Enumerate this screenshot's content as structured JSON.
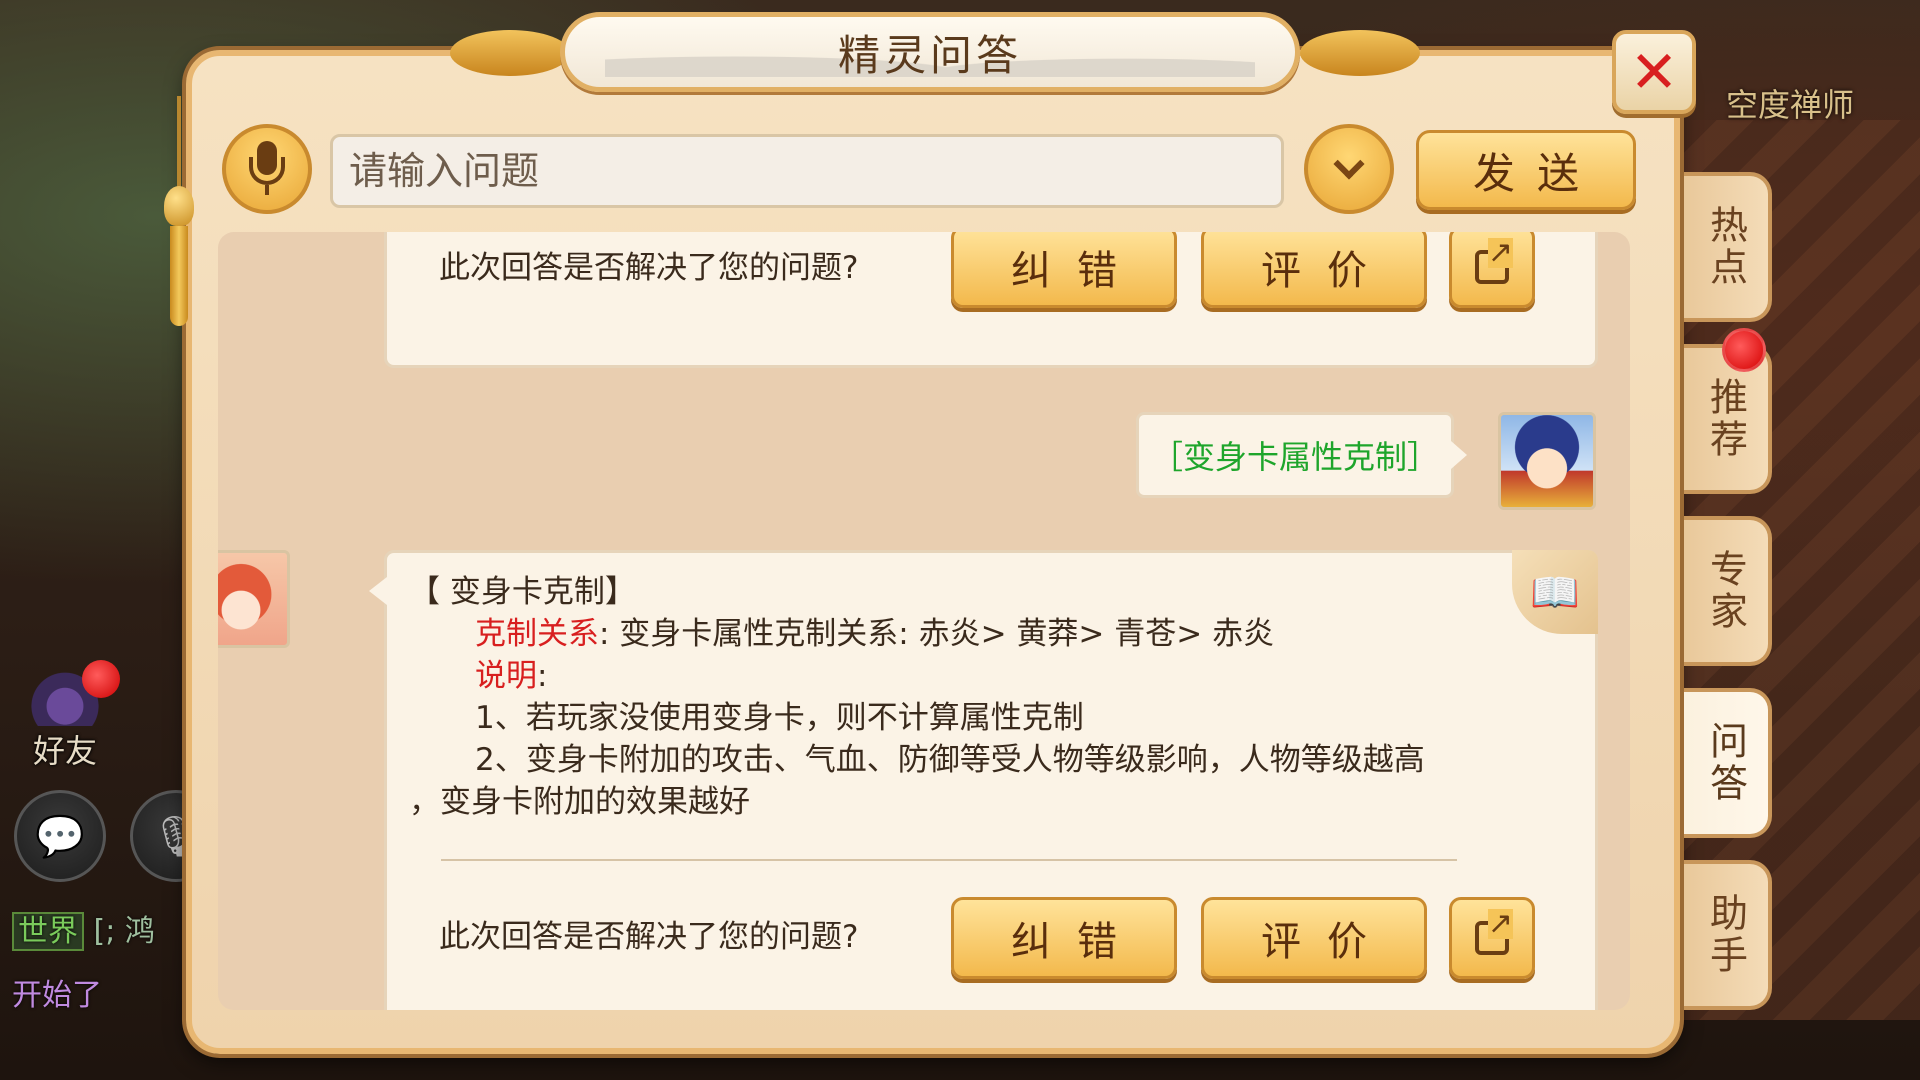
{
  "background": {
    "npc_name": "空度禅师",
    "hud": {
      "friend_label": "好友",
      "chat_world_tag": "世界",
      "chat_world_text": "[; 鸿",
      "chat_begin_text": "开始了"
    }
  },
  "dialog": {
    "title": "精灵问答",
    "search": {
      "placeholder": "请输入问题",
      "value": ""
    },
    "send_label": "发送",
    "tabs": [
      {
        "label": "热点",
        "active": false
      },
      {
        "label": "推荐",
        "active": false,
        "has_badge": true
      },
      {
        "label": "专家",
        "active": false
      },
      {
        "label": "问答",
        "active": true
      },
      {
        "label": "助手",
        "active": false
      }
    ],
    "messages": {
      "previous_feedback": {
        "question": "此次回答是否解决了您的问题?",
        "correct_label": "纠错",
        "rate_label": "评价"
      },
      "user_query": "［变身卡属性克制］",
      "answer": {
        "heading": "【 变身卡克制】",
        "restraint_label": "克制关系",
        "restraint_text": ": 变身卡属性克制关系: 赤炎> 黄莽> 青苍> 赤炎",
        "note_label": "说明",
        "note_colon": ":",
        "item1": "1、若玩家没使用变身卡，则不计算属性克制",
        "item2": "2、变身卡附加的攻击、气血、防御等受人物等级影响，人物等级越高",
        "item2_cont": "，变身卡附加的效果越好"
      },
      "current_feedback": {
        "question": "此次回答是否解决了您的问题?",
        "correct_label": "纠错",
        "rate_label": "评价"
      }
    }
  },
  "colors": {
    "accent_gold": "#f3b94c",
    "highlight_red": "#d81f1f",
    "user_query_green": "#1ea52b",
    "panel_bg": "#f6e2c2"
  }
}
